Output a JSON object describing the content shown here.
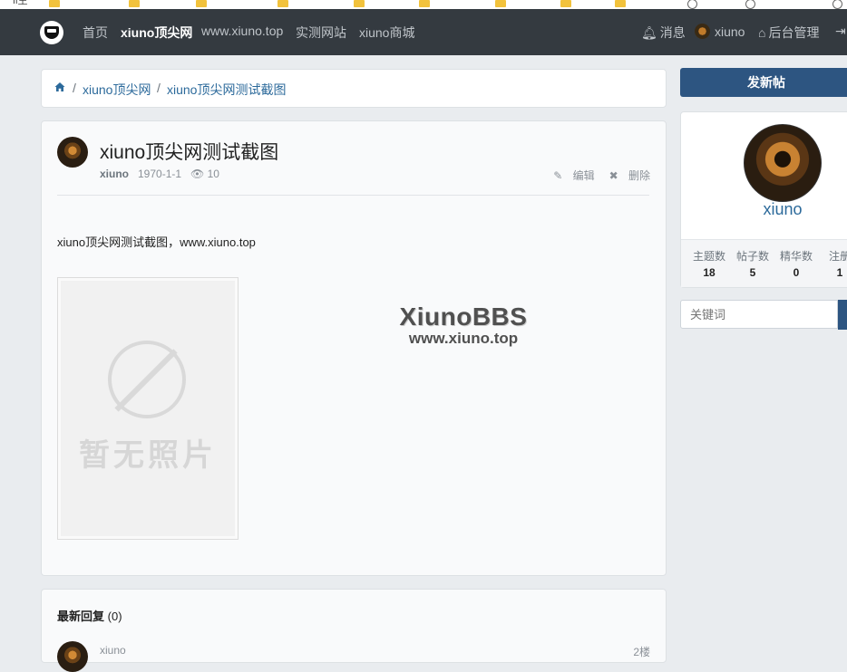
{
  "nav": {
    "home": "首页",
    "site": "xiuno顶尖网",
    "url": "www.xiuno.top",
    "test_site": "实测网站",
    "shop": "xiuno商城",
    "messages": "消息",
    "user": "xiuno",
    "admin": "后台管理"
  },
  "breadcrumb": {
    "level1": "xiuno顶尖网",
    "level2": "xiuno顶尖网测试截图"
  },
  "post": {
    "title": "xiuno顶尖网测试截图",
    "author": "xiuno",
    "date": "1970-1-1",
    "views": "10",
    "edit": "编辑",
    "delete": "删除",
    "body": "xiuno顶尖网测试截图，www.xiuno.top",
    "image_placeholder": "暂无照片",
    "watermark_title": "XiunoBBS",
    "watermark_url": "www.xiuno.top"
  },
  "replies": {
    "title": "最新回复",
    "count": "(0)",
    "first_author": "xiuno",
    "first_floor": "2楼"
  },
  "sidebar": {
    "new_post": "发新帖",
    "username": "xiuno",
    "stats": [
      {
        "label": "主题数",
        "value": "18"
      },
      {
        "label": "帖子数",
        "value": "5"
      },
      {
        "label": "精华数",
        "value": "0"
      },
      {
        "label": "注册",
        "value": "1"
      }
    ],
    "search_placeholder": "关键词"
  },
  "colors": {
    "navbar": "#343a40",
    "primary": "#2d5581",
    "link": "#2c6a9b"
  }
}
